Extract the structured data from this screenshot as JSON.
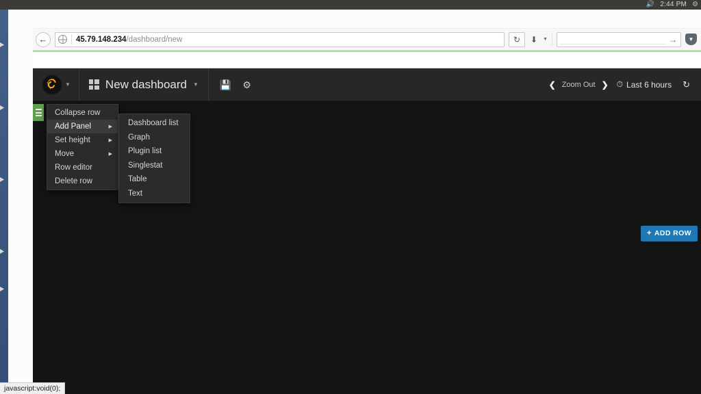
{
  "desktop": {
    "tray": {
      "volume_icon": "volume-icon",
      "clock": "2:44 PM",
      "settings_icon": "system-settings-icon"
    }
  },
  "browser": {
    "back_icon": "back-arrow-icon",
    "site_icon": "globe-icon",
    "url": {
      "host": "45.79.148.234",
      "path": "/dashboard/new"
    },
    "reload_icon": "reload-icon",
    "download_icon": "download-icon",
    "download_caret": "chevron-down-icon",
    "search": {
      "value": "",
      "placeholder": "",
      "go_icon": "arrow-right-icon"
    },
    "shield_icon": "shield-icon"
  },
  "grafana": {
    "logo_icon": "grafana-logo-icon",
    "logo_caret": "chevron-down-icon",
    "dashboard_grid_icon": "dashboard-grid-icon",
    "dashboard_name": "New dashboard",
    "dashboard_caret": "chevron-down-icon",
    "save_icon": "save-floppy-icon",
    "settings_icon": "gear-icon",
    "zoom_prev_icon": "chevron-left-icon",
    "zoom_out_label": "Zoom Out",
    "zoom_next_icon": "chevron-right-icon",
    "time_clock_icon": "clock-icon",
    "time_range": "Last 6 hours",
    "refresh_icon": "refresh-icon",
    "row_handle_icon": "row-menu-hamburger-icon",
    "row_menu": {
      "items": [
        {
          "label": "Collapse row",
          "has_submenu": false,
          "active": false
        },
        {
          "label": "Add Panel",
          "has_submenu": true,
          "active": true
        },
        {
          "label": "Set height",
          "has_submenu": true,
          "active": false
        },
        {
          "label": "Move",
          "has_submenu": true,
          "active": false
        },
        {
          "label": "Row editor",
          "has_submenu": false,
          "active": false
        },
        {
          "label": "Delete row",
          "has_submenu": false,
          "active": false
        }
      ],
      "submenu_arrow": "chevron-right-icon"
    },
    "add_panel_submenu": {
      "items": [
        {
          "label": "Dashboard list"
        },
        {
          "label": "Graph"
        },
        {
          "label": "Plugin list"
        },
        {
          "label": "Singlestat"
        },
        {
          "label": "Table"
        },
        {
          "label": "Text"
        }
      ]
    },
    "add_row_button": {
      "plus": "+",
      "label": "ADD ROW"
    }
  },
  "statusbar": {
    "text": "javascript:void(0);"
  },
  "colors": {
    "accent_blue": "#1f78b4",
    "row_green": "#629e51",
    "panel_bg": "#2b2b2b",
    "app_bg": "#141414",
    "navbar_bg": "#272727"
  }
}
